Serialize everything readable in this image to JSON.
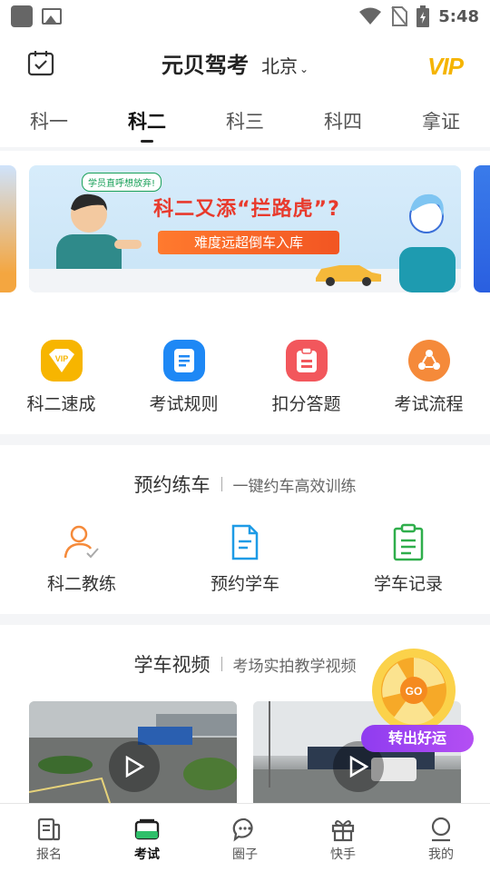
{
  "status_bar": {
    "time": "5:48"
  },
  "header": {
    "title": "元贝驾考",
    "city": "北京",
    "vip_label": "VIP"
  },
  "tabs": [
    {
      "label": "科一",
      "active": false
    },
    {
      "label": "科二",
      "active": true
    },
    {
      "label": "科三",
      "active": false
    },
    {
      "label": "科四",
      "active": false
    },
    {
      "label": "拿证",
      "active": false
    }
  ],
  "banner": {
    "tag": "学员直呼想放弃!",
    "headline": "科二又添“拦路虎”?",
    "subline": "难度远超倒车入库"
  },
  "quick_menu": [
    {
      "label": "科二速成",
      "icon": "vip-badge-icon",
      "color": "#f7b500"
    },
    {
      "label": "考试规则",
      "icon": "document-icon",
      "color": "#1e88f5"
    },
    {
      "label": "扣分答题",
      "icon": "clipboard-minus-icon",
      "color": "#f2575c"
    },
    {
      "label": "考试流程",
      "icon": "flow-icon",
      "color": "#f58a3a"
    }
  ],
  "booking": {
    "title": "预约练车",
    "subtitle": "一键约车高效训练",
    "items": [
      {
        "label": "科二教练",
        "icon": "coach-icon"
      },
      {
        "label": "预约学车",
        "icon": "file-icon"
      },
      {
        "label": "学车记录",
        "icon": "record-icon"
      }
    ]
  },
  "videos": {
    "title": "学车视频",
    "subtitle": "考场实拍教学视频"
  },
  "lucky": {
    "button": "转出好运",
    "wheel_text": "GO"
  },
  "bottom_nav": [
    {
      "label": "报名",
      "icon": "signup-icon",
      "active": false
    },
    {
      "label": "考试",
      "icon": "exam-icon",
      "active": true
    },
    {
      "label": "圈子",
      "icon": "chat-icon",
      "active": false
    },
    {
      "label": "快手",
      "icon": "gift-icon",
      "active": false
    },
    {
      "label": "我的",
      "icon": "profile-icon",
      "active": false
    }
  ]
}
